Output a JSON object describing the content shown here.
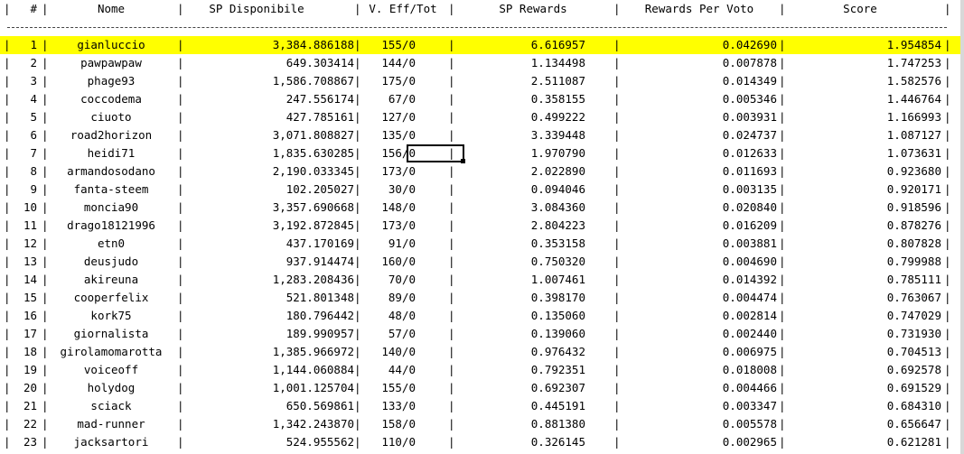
{
  "header": {
    "num": "#",
    "nome": "Nome",
    "sp": "SP Disponibile",
    "veff": "V. Eff/Tot",
    "rew": "SP Rewards",
    "rpv": "Rewards Per Voto",
    "score": "Score"
  },
  "separator": "|",
  "highlight_color": "#ffff00",
  "rows": [
    {
      "num": "1",
      "nome": "gianluccio",
      "sp": "3,384.886188",
      "veff": "155/0",
      "rew": "6.616957",
      "rpv": "0.042690",
      "score": "1.954854"
    },
    {
      "num": "2",
      "nome": "pawpawpaw",
      "sp": "649.303414",
      "veff": "144/0",
      "rew": "1.134498",
      "rpv": "0.007878",
      "score": "1.747253"
    },
    {
      "num": "3",
      "nome": "phage93",
      "sp": "1,586.708867",
      "veff": "175/0",
      "rew": "2.511087",
      "rpv": "0.014349",
      "score": "1.582576"
    },
    {
      "num": "4",
      "nome": "coccodema",
      "sp": "247.556174",
      "veff": "67/0",
      "rew": "0.358155",
      "rpv": "0.005346",
      "score": "1.446764"
    },
    {
      "num": "5",
      "nome": "ciuoto",
      "sp": "427.785161",
      "veff": "127/0",
      "rew": "0.499222",
      "rpv": "0.003931",
      "score": "1.166993"
    },
    {
      "num": "6",
      "nome": "road2horizon",
      "sp": "3,071.808827",
      "veff": "135/0",
      "rew": "3.339448",
      "rpv": "0.024737",
      "score": "1.087127"
    },
    {
      "num": "7",
      "nome": "heidi71",
      "sp": "1,835.630285",
      "veff": "156/0",
      "rew": "1.970790",
      "rpv": "0.012633",
      "score": "1.073631"
    },
    {
      "num": "8",
      "nome": "armandosodano",
      "sp": "2,190.033345",
      "veff": "173/0",
      "rew": "2.022890",
      "rpv": "0.011693",
      "score": "0.923680"
    },
    {
      "num": "9",
      "nome": "fanta-steem",
      "sp": "102.205027",
      "veff": "30/0",
      "rew": "0.094046",
      "rpv": "0.003135",
      "score": "0.920171"
    },
    {
      "num": "10",
      "nome": "moncia90",
      "sp": "3,357.690668",
      "veff": "148/0",
      "rew": "3.084360",
      "rpv": "0.020840",
      "score": "0.918596"
    },
    {
      "num": "11",
      "nome": "drago18121996",
      "sp": "3,192.872845",
      "veff": "173/0",
      "rew": "2.804223",
      "rpv": "0.016209",
      "score": "0.878276"
    },
    {
      "num": "12",
      "nome": "etn0",
      "sp": "437.170169",
      "veff": "91/0",
      "rew": "0.353158",
      "rpv": "0.003881",
      "score": "0.807828"
    },
    {
      "num": "13",
      "nome": "deusjudo",
      "sp": "937.914474",
      "veff": "160/0",
      "rew": "0.750320",
      "rpv": "0.004690",
      "score": "0.799988"
    },
    {
      "num": "14",
      "nome": "akireuna",
      "sp": "1,283.208436",
      "veff": "70/0",
      "rew": "1.007461",
      "rpv": "0.014392",
      "score": "0.785111"
    },
    {
      "num": "15",
      "nome": "cooperfelix",
      "sp": "521.801348",
      "veff": "89/0",
      "rew": "0.398170",
      "rpv": "0.004474",
      "score": "0.763067"
    },
    {
      "num": "16",
      "nome": "kork75",
      "sp": "180.796442",
      "veff": "48/0",
      "rew": "0.135060",
      "rpv": "0.002814",
      "score": "0.747029"
    },
    {
      "num": "17",
      "nome": "giornalista",
      "sp": "189.990957",
      "veff": "57/0",
      "rew": "0.139060",
      "rpv": "0.002440",
      "score": "0.731930"
    },
    {
      "num": "18",
      "nome": "girolamomarotta",
      "sp": "1,385.966972",
      "veff": "140/0",
      "rew": "0.976432",
      "rpv": "0.006975",
      "score": "0.704513"
    },
    {
      "num": "19",
      "nome": "voiceoff",
      "sp": "1,144.060884",
      "veff": "44/0",
      "rew": "0.792351",
      "rpv": "0.018008",
      "score": "0.692578"
    },
    {
      "num": "20",
      "nome": "holydog",
      "sp": "1,001.125704",
      "veff": "155/0",
      "rew": "0.692307",
      "rpv": "0.004466",
      "score": "0.691529"
    },
    {
      "num": "21",
      "nome": "sciack",
      "sp": "650.569861",
      "veff": "133/0",
      "rew": "0.445191",
      "rpv": "0.003347",
      "score": "0.684310"
    },
    {
      "num": "22",
      "nome": "mad-runner",
      "sp": "1,342.243870",
      "veff": "158/0",
      "rew": "0.881380",
      "rpv": "0.005578",
      "score": "0.656647"
    },
    {
      "num": "23",
      "nome": "jacksartori",
      "sp": "524.955562",
      "veff": "110/0",
      "rew": "0.326145",
      "rpv": "0.002965",
      "score": "0.621281"
    }
  ]
}
